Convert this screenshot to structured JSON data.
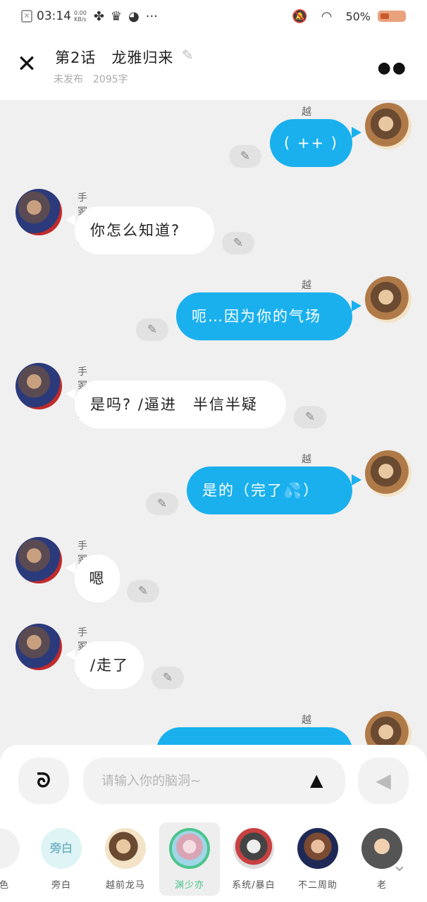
{
  "status_bar": {
    "time": "03:14",
    "net_speed": "0.00",
    "net_unit": "KB/s",
    "battery": "50%",
    "icons": [
      "close-notification-icon",
      "fan-icon",
      "crown-icon",
      "cat-icon",
      "more-dots-icon",
      "mute-icon",
      "wifi-icon",
      "battery-icon"
    ]
  },
  "header": {
    "title": "第2话　龙雅归来",
    "subtitle": "未发布　2095字"
  },
  "messages": [
    {
      "side": "right",
      "name": "越前龙马",
      "text": "( ++ )"
    },
    {
      "side": "left",
      "name": "手冢国光",
      "text": "你怎么知道?"
    },
    {
      "side": "right",
      "name": "越前龙马",
      "text": "呃…因为你的气场"
    },
    {
      "side": "left",
      "name": "手冢国光",
      "text": "是吗? /逼进　半信半疑"
    },
    {
      "side": "right",
      "name": "越前龙马",
      "text": "是的（完了💦）"
    },
    {
      "side": "left",
      "name": "手冢国光",
      "text": "嗯"
    },
    {
      "side": "left",
      "name": "手冢国光",
      "text": "/走了"
    },
    {
      "side": "right",
      "name": "越前龙马",
      "text": ""
    }
  ],
  "input": {
    "placeholder": "请输入你的脑洞~"
  },
  "characters": [
    {
      "label": "角色",
      "selected": false
    },
    {
      "label": "旁白",
      "avatar_text": "旁白",
      "selected": false
    },
    {
      "label": "越前龙马",
      "selected": false
    },
    {
      "label": "渊少亦",
      "selected": true
    },
    {
      "label": "系统/暴白",
      "selected": false
    },
    {
      "label": "不二周助",
      "selected": false
    },
    {
      "label": "老",
      "selected": false
    }
  ],
  "colors": {
    "accent_blue": "#1ab0ee",
    "selected_green": "#4cc48c"
  }
}
